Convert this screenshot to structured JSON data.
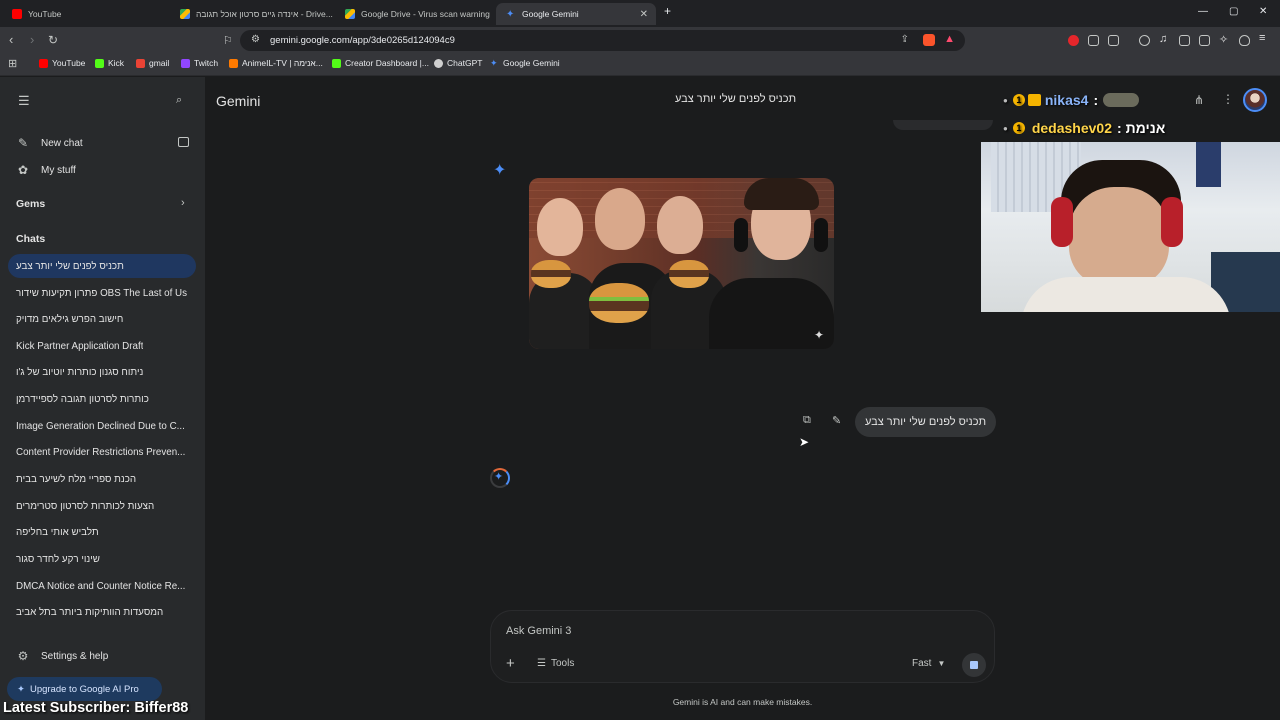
{
  "browser": {
    "tabs": [
      {
        "title": "YouTube",
        "color": "#ff0000"
      },
      {
        "title": "אינדה גיים סרטון אוכל תגובה - Drive...",
        "color": "#4a8af4"
      },
      {
        "title": "Google Drive - Virus scan warning",
        "color": "#34a853"
      },
      {
        "title": "Google Gemini",
        "color": "#4c8df6",
        "active": true
      }
    ],
    "new_tab": "+",
    "url": "gemini.google.com/app/3de0265d124094c9",
    "window_controls": [
      "—",
      "▢",
      "✕"
    ]
  },
  "bookmarks": [
    {
      "label": "YouTube",
      "color": "#ff0000"
    },
    {
      "label": "Kick",
      "color": "#53fc18"
    },
    {
      "label": "gmail",
      "color": "#ea4335"
    },
    {
      "label": "Twitch",
      "color": "#9146ff"
    },
    {
      "label": "AnimeIL-TV | אנימה...",
      "color": "#ff7a00"
    },
    {
      "label": "Creator Dashboard |...",
      "color": "#53fc18"
    },
    {
      "label": "ChatGPT",
      "color": "#cfcfcf"
    },
    {
      "label": "Google Gemini",
      "color": "#4c8df6"
    }
  ],
  "sidebar": {
    "new_chat": "New chat",
    "my_stuff": "My stuff",
    "gems": "Gems",
    "chats_header": "Chats",
    "chats": [
      "תכניס לפנים שלי יותר צבע",
      "OBS The Last of Us פתרון תקיעות שידור",
      "חישוב הפרש גילאים מדויק",
      "Kick Partner Application Draft",
      "ניתוח סגנון כותרות יוטיוב של ג'ו",
      "כותרות לסרטון תגובה לספיידרמן",
      "Image Generation Declined Due to C...",
      "Content Provider Restrictions Preven...",
      "הכנת ספריי מלח לשיער בבית",
      "הצעות לכותרות לסרטון סטרימרים",
      "תלביש אותי בחליפה",
      "שינוי רקע לחדר סגור",
      "DMCA Notice and Counter Notice Re...",
      "המסעדות הוותיקות ביותר בתל אביב"
    ],
    "settings": "Settings & help",
    "upgrade": "Upgrade to Google AI Pro"
  },
  "main": {
    "brand": "Gemini",
    "chat_title": "תכניס לפנים שלי יותר צבע",
    "user_message": "תכניס לפנים שלי יותר צבע",
    "input_placeholder": "Ask Gemini 3",
    "tools_label": "Tools",
    "mode_label": "Fast",
    "disclaimer": "Gemini is AI and can make mistakes."
  },
  "stream": {
    "line1_name": "nikas4",
    "line1_sep": ":",
    "line2_prefix": "אנימת :",
    "line2_name": "dedashev02",
    "badge_num": "1",
    "latest_subscriber": "Latest Subscriber: Biffer88"
  },
  "colors": {
    "accent": "#4c8df6",
    "active_chat": "#1f3760",
    "nick1": "#8ab4f8",
    "nick2": "#ffd54a"
  }
}
